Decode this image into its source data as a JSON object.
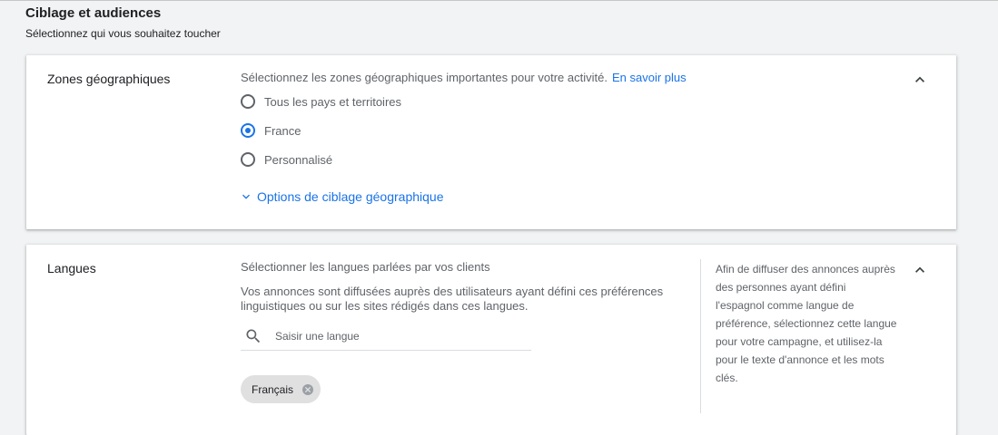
{
  "header": {
    "title": "Ciblage et audiences",
    "subtitle": "Sélectionnez qui vous souhaitez toucher"
  },
  "geo": {
    "title": "Zones géographiques",
    "description": "Sélectionnez les zones géographiques importantes pour votre activité.",
    "learn_more": "En savoir plus",
    "options": [
      {
        "label": "Tous les pays et territoires",
        "checked": false
      },
      {
        "label": "France",
        "checked": true
      },
      {
        "label": "Personnalisé",
        "checked": false
      }
    ],
    "targeting_options_link": "Options de ciblage géographique",
    "collapse_icon": "chevron-up-icon"
  },
  "languages": {
    "title": "Langues",
    "description": "Sélectionner les langues parlées par vos clients",
    "detail": "Vos annonces sont diffusées auprès des utilisateurs ayant défini ces préférences linguistiques ou sur les sites rédigés dans ces langues.",
    "search_placeholder": "Saisir une langue",
    "selected": [
      "Français"
    ],
    "help_text": "Afin de diffuser des annonces auprès des personnes ayant défini l'espagnol comme langue de préférence, sélectionnez cette langue pour votre campagne, et utilisez-la pour le texte d'annonce et les mots clés.",
    "collapse_icon": "chevron-up-icon"
  },
  "colors": {
    "link": "#1a73e8",
    "text": "#5f6368",
    "background": "#f1f3f4"
  }
}
